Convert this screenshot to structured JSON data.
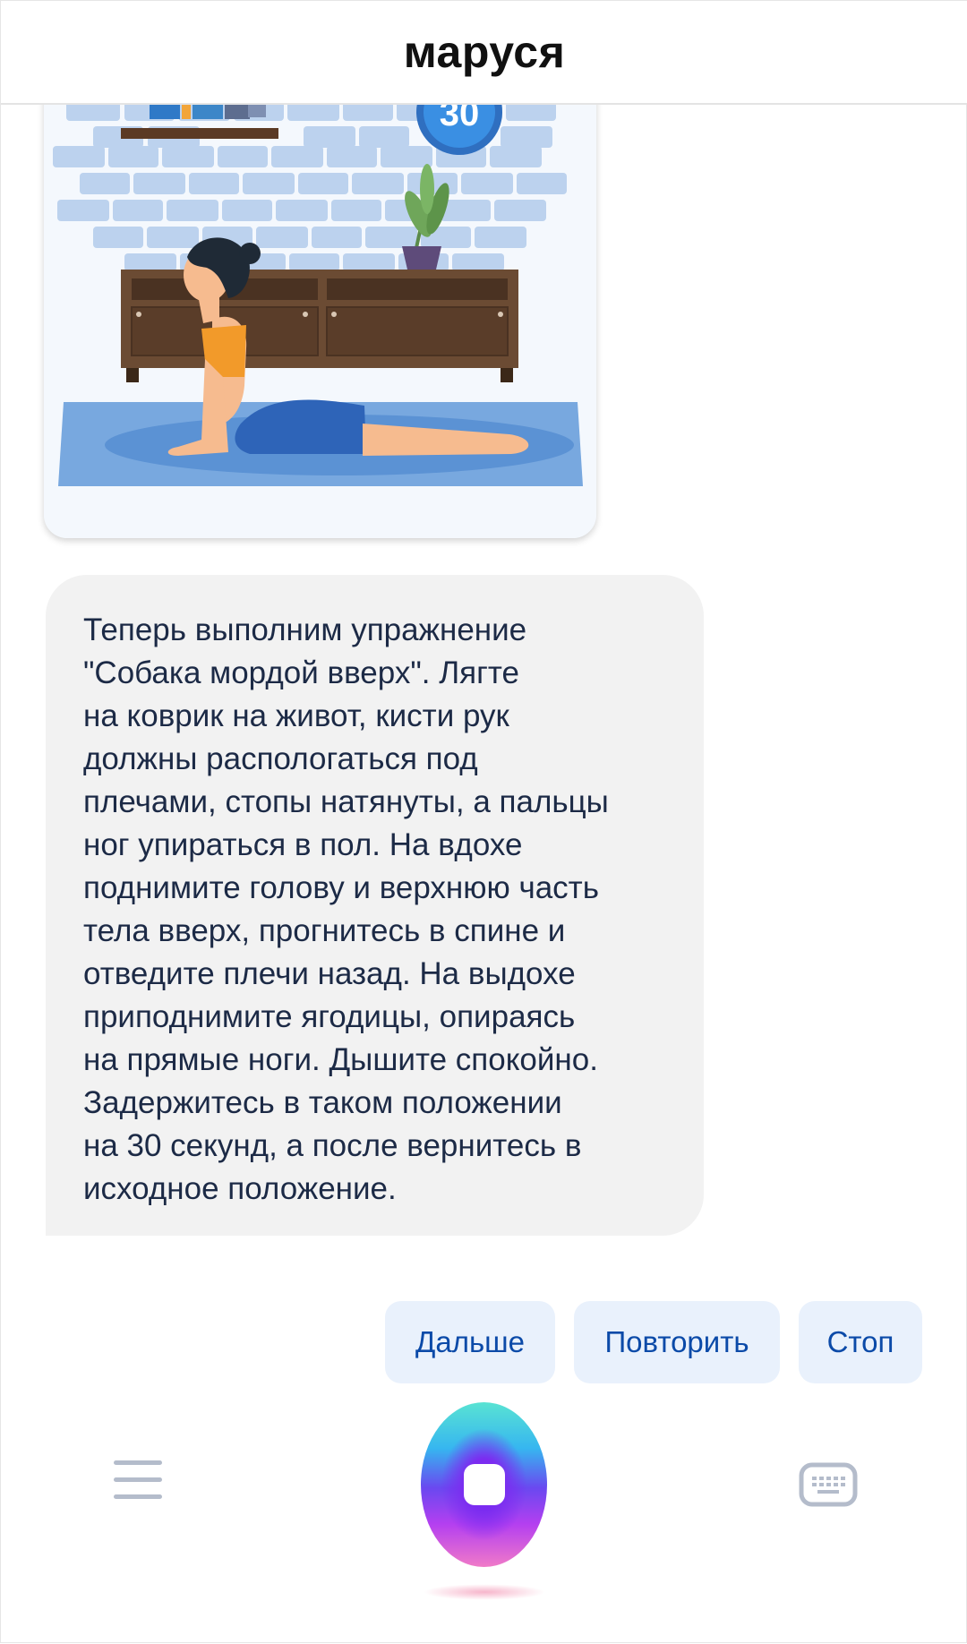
{
  "header": {
    "title": "маруся"
  },
  "image": {
    "badge": "30"
  },
  "message": {
    "lines": [
      "Теперь выполним упражнение",
      "\"Собака мордой вверх\". Лягте",
      "на коврик на живот, кисти рук",
      "должны распологаться под",
      "плечами, стопы натянуты, а пальцы",
      "ног упираться в пол. На вдохе",
      "поднимите голову и верхнюю часть",
      "тела вверх, прогнитесь в спине и",
      "отведите плечи назад. На выдохе",
      "приподнимите ягодицы, опираясь",
      "на прямые ноги. Дышите спокойно.",
      "Задержитесь в таком положении",
      "на 30 секунд, а после вернитесь в",
      "исходное положение."
    ]
  },
  "suggestions": [
    {
      "label": "Дальше"
    },
    {
      "label": "Повторить"
    },
    {
      "label": "Стоп"
    }
  ],
  "bottom_bar": {
    "menu_icon": "hamburger-menu-icon",
    "mic_icon": "stop-icon",
    "keyboard_icon": "keyboard-icon"
  },
  "colors": {
    "accent": "#0b4aa8",
    "chip_bg": "#e9f1fc",
    "bubble_bg": "#f2f2f2",
    "text": "#1c2a46"
  }
}
